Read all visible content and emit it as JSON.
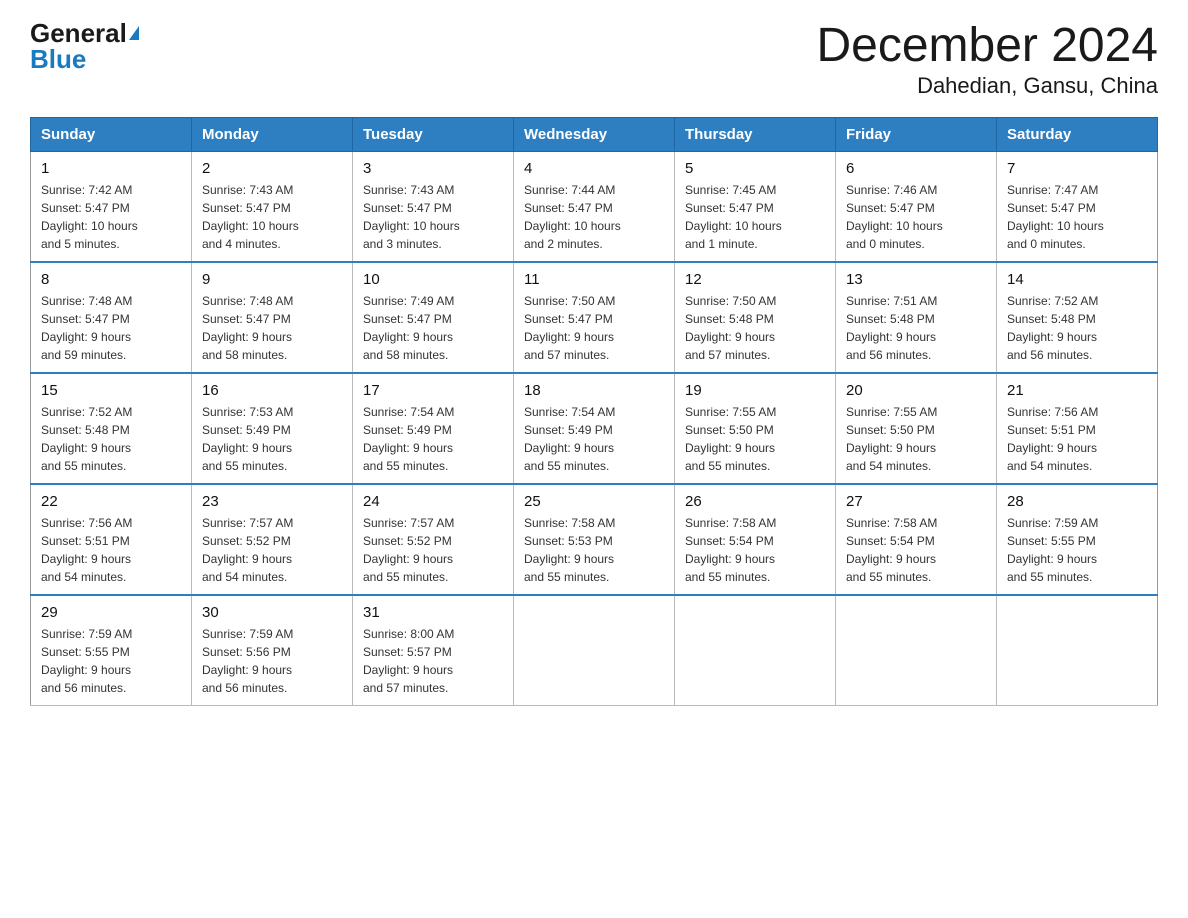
{
  "header": {
    "logo_general": "General",
    "logo_blue": "Blue",
    "month_title": "December 2024",
    "location": "Dahedian, Gansu, China"
  },
  "days_of_week": [
    "Sunday",
    "Monday",
    "Tuesday",
    "Wednesday",
    "Thursday",
    "Friday",
    "Saturday"
  ],
  "weeks": [
    [
      {
        "day": "1",
        "sunrise": "7:42 AM",
        "sunset": "5:47 PM",
        "daylight": "10 hours and 5 minutes."
      },
      {
        "day": "2",
        "sunrise": "7:43 AM",
        "sunset": "5:47 PM",
        "daylight": "10 hours and 4 minutes."
      },
      {
        "day": "3",
        "sunrise": "7:43 AM",
        "sunset": "5:47 PM",
        "daylight": "10 hours and 3 minutes."
      },
      {
        "day": "4",
        "sunrise": "7:44 AM",
        "sunset": "5:47 PM",
        "daylight": "10 hours and 2 minutes."
      },
      {
        "day": "5",
        "sunrise": "7:45 AM",
        "sunset": "5:47 PM",
        "daylight": "10 hours and 1 minute."
      },
      {
        "day": "6",
        "sunrise": "7:46 AM",
        "sunset": "5:47 PM",
        "daylight": "10 hours and 0 minutes."
      },
      {
        "day": "7",
        "sunrise": "7:47 AM",
        "sunset": "5:47 PM",
        "daylight": "10 hours and 0 minutes."
      }
    ],
    [
      {
        "day": "8",
        "sunrise": "7:48 AM",
        "sunset": "5:47 PM",
        "daylight": "9 hours and 59 minutes."
      },
      {
        "day": "9",
        "sunrise": "7:48 AM",
        "sunset": "5:47 PM",
        "daylight": "9 hours and 58 minutes."
      },
      {
        "day": "10",
        "sunrise": "7:49 AM",
        "sunset": "5:47 PM",
        "daylight": "9 hours and 58 minutes."
      },
      {
        "day": "11",
        "sunrise": "7:50 AM",
        "sunset": "5:47 PM",
        "daylight": "9 hours and 57 minutes."
      },
      {
        "day": "12",
        "sunrise": "7:50 AM",
        "sunset": "5:48 PM",
        "daylight": "9 hours and 57 minutes."
      },
      {
        "day": "13",
        "sunrise": "7:51 AM",
        "sunset": "5:48 PM",
        "daylight": "9 hours and 56 minutes."
      },
      {
        "day": "14",
        "sunrise": "7:52 AM",
        "sunset": "5:48 PM",
        "daylight": "9 hours and 56 minutes."
      }
    ],
    [
      {
        "day": "15",
        "sunrise": "7:52 AM",
        "sunset": "5:48 PM",
        "daylight": "9 hours and 55 minutes."
      },
      {
        "day": "16",
        "sunrise": "7:53 AM",
        "sunset": "5:49 PM",
        "daylight": "9 hours and 55 minutes."
      },
      {
        "day": "17",
        "sunrise": "7:54 AM",
        "sunset": "5:49 PM",
        "daylight": "9 hours and 55 minutes."
      },
      {
        "day": "18",
        "sunrise": "7:54 AM",
        "sunset": "5:49 PM",
        "daylight": "9 hours and 55 minutes."
      },
      {
        "day": "19",
        "sunrise": "7:55 AM",
        "sunset": "5:50 PM",
        "daylight": "9 hours and 55 minutes."
      },
      {
        "day": "20",
        "sunrise": "7:55 AM",
        "sunset": "5:50 PM",
        "daylight": "9 hours and 54 minutes."
      },
      {
        "day": "21",
        "sunrise": "7:56 AM",
        "sunset": "5:51 PM",
        "daylight": "9 hours and 54 minutes."
      }
    ],
    [
      {
        "day": "22",
        "sunrise": "7:56 AM",
        "sunset": "5:51 PM",
        "daylight": "9 hours and 54 minutes."
      },
      {
        "day": "23",
        "sunrise": "7:57 AM",
        "sunset": "5:52 PM",
        "daylight": "9 hours and 54 minutes."
      },
      {
        "day": "24",
        "sunrise": "7:57 AM",
        "sunset": "5:52 PM",
        "daylight": "9 hours and 55 minutes."
      },
      {
        "day": "25",
        "sunrise": "7:58 AM",
        "sunset": "5:53 PM",
        "daylight": "9 hours and 55 minutes."
      },
      {
        "day": "26",
        "sunrise": "7:58 AM",
        "sunset": "5:54 PM",
        "daylight": "9 hours and 55 minutes."
      },
      {
        "day": "27",
        "sunrise": "7:58 AM",
        "sunset": "5:54 PM",
        "daylight": "9 hours and 55 minutes."
      },
      {
        "day": "28",
        "sunrise": "7:59 AM",
        "sunset": "5:55 PM",
        "daylight": "9 hours and 55 minutes."
      }
    ],
    [
      {
        "day": "29",
        "sunrise": "7:59 AM",
        "sunset": "5:55 PM",
        "daylight": "9 hours and 56 minutes."
      },
      {
        "day": "30",
        "sunrise": "7:59 AM",
        "sunset": "5:56 PM",
        "daylight": "9 hours and 56 minutes."
      },
      {
        "day": "31",
        "sunrise": "8:00 AM",
        "sunset": "5:57 PM",
        "daylight": "9 hours and 57 minutes."
      },
      null,
      null,
      null,
      null
    ]
  ],
  "labels": {
    "sunrise": "Sunrise:",
    "sunset": "Sunset:",
    "daylight": "Daylight:"
  }
}
